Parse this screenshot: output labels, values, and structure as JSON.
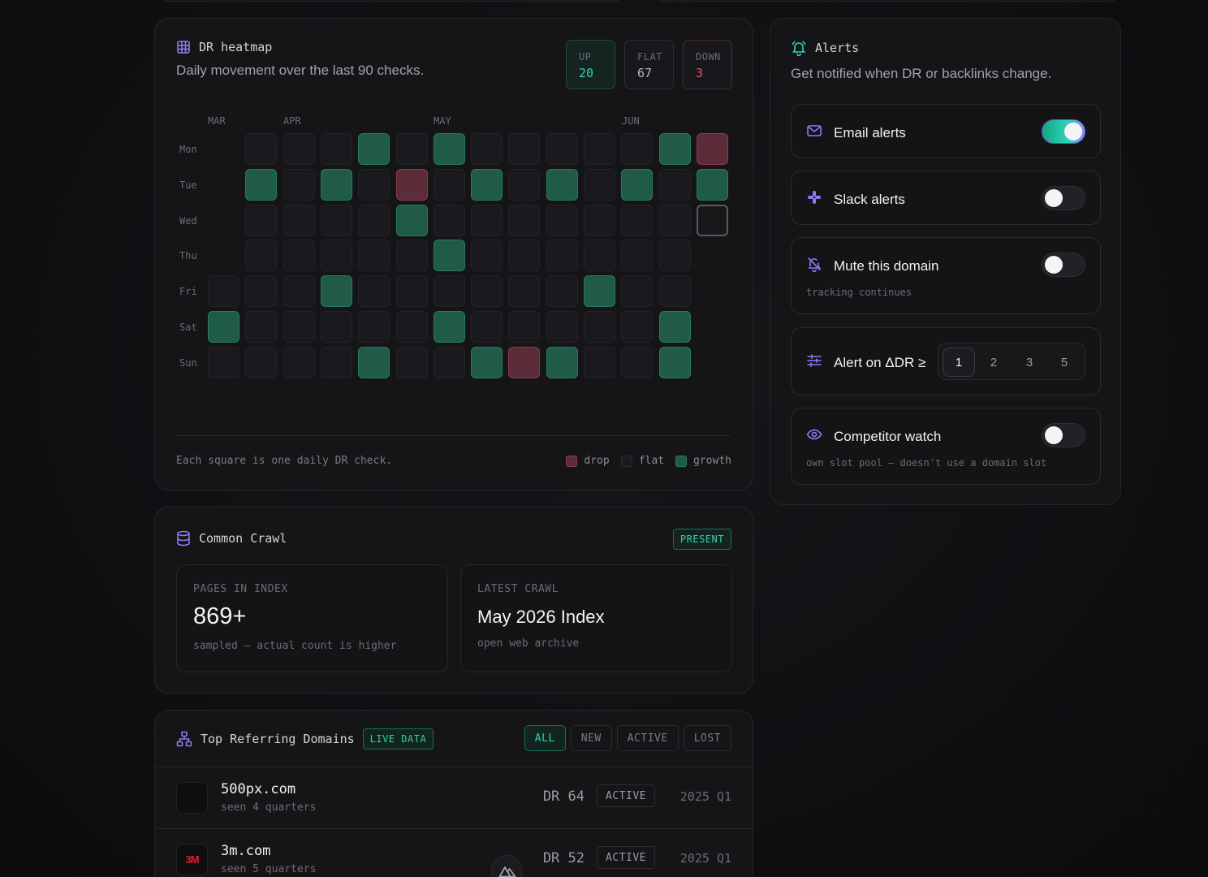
{
  "heatmap": {
    "title": "DR heatmap",
    "subtitle": "Daily movement over the last 90 checks.",
    "stats": [
      {
        "label": "UP",
        "value": "20"
      },
      {
        "label": "FLAT",
        "value": "67"
      },
      {
        "label": "DOWN",
        "value": "3"
      }
    ],
    "months": [
      "MAR",
      "APR",
      "MAY",
      "JUN"
    ],
    "days": [
      "Mon",
      "Tue",
      "Wed",
      "Thu",
      "Fri",
      "Sat",
      "Sun"
    ],
    "columns": [
      [
        "",
        "",
        "",
        "",
        "f",
        "g",
        "f"
      ],
      [
        "f",
        "g",
        "f",
        "f",
        "f",
        "f",
        "f"
      ],
      [
        "f",
        "f",
        "f",
        "f",
        "f",
        "f",
        "f"
      ],
      [
        "f",
        "g",
        "f",
        "f",
        "g",
        "f",
        "f"
      ],
      [
        "g",
        "f",
        "f",
        "f",
        "f",
        "f",
        "g"
      ],
      [
        "f",
        "d",
        "g",
        "f",
        "f",
        "f",
        "f"
      ],
      [
        "g",
        "f",
        "f",
        "g",
        "f",
        "g",
        "f"
      ],
      [
        "f",
        "g",
        "f",
        "f",
        "f",
        "f",
        "g"
      ],
      [
        "f",
        "f",
        "f",
        "f",
        "f",
        "f",
        "d"
      ],
      [
        "f",
        "g",
        "f",
        "f",
        "f",
        "f",
        "g"
      ],
      [
        "f",
        "f",
        "f",
        "f",
        "g",
        "f",
        "f"
      ],
      [
        "f",
        "g",
        "f",
        "f",
        "f",
        "f",
        "f"
      ],
      [
        "g",
        "f",
        "f",
        "f",
        "f",
        "g",
        "g"
      ],
      [
        "d",
        "g",
        "c",
        "",
        "",
        "",
        ""
      ]
    ],
    "footnote": "Each square is one daily DR check.",
    "legend": [
      "drop",
      "flat",
      "growth"
    ],
    "colors": {
      "growth": "#1f5b47",
      "drop": "#5a2d38",
      "flat": "#1a1a1e",
      "up": "#34d3a4",
      "down": "#e0566a"
    }
  },
  "alerts": {
    "title": "Alerts",
    "subtitle": "Get notified when DR or backlinks change.",
    "email": {
      "label": "Email alerts",
      "on": true
    },
    "slack": {
      "label": "Slack alerts",
      "on": false
    },
    "mute": {
      "label": "Mute this domain",
      "hint": "tracking continues",
      "on": false
    },
    "threshold": {
      "label": "Alert on ΔDR ≥",
      "options": [
        "1",
        "2",
        "3",
        "5"
      ],
      "selected": "1"
    },
    "competitor": {
      "label": "Competitor watch",
      "hint": "own slot pool — doesn't use a domain slot",
      "on": false
    }
  },
  "crawl": {
    "title": "Common Crawl",
    "badge": "PRESENT",
    "pages": {
      "label": "PAGES IN INDEX",
      "value": "869+",
      "sub": "sampled — actual count is higher"
    },
    "latest": {
      "label": "LATEST CRAWL",
      "value": "May 2026 Index",
      "sub": "open web archive"
    }
  },
  "domains": {
    "title": "Top Referring Domains",
    "badge": "LIVE DATA",
    "filters": [
      "ALL",
      "NEW",
      "ACTIVE",
      "LOST"
    ],
    "rows": [
      {
        "name": "500px.com",
        "seen": "seen 4 quarters",
        "dr": "DR 64",
        "status": "ACTIVE",
        "quarter": "2025 Q1"
      },
      {
        "name": "3m.com",
        "seen": "seen 5 quarters",
        "dr": "DR 52",
        "status": "ACTIVE",
        "quarter": "2025 Q1",
        "logo": "3M"
      }
    ]
  }
}
